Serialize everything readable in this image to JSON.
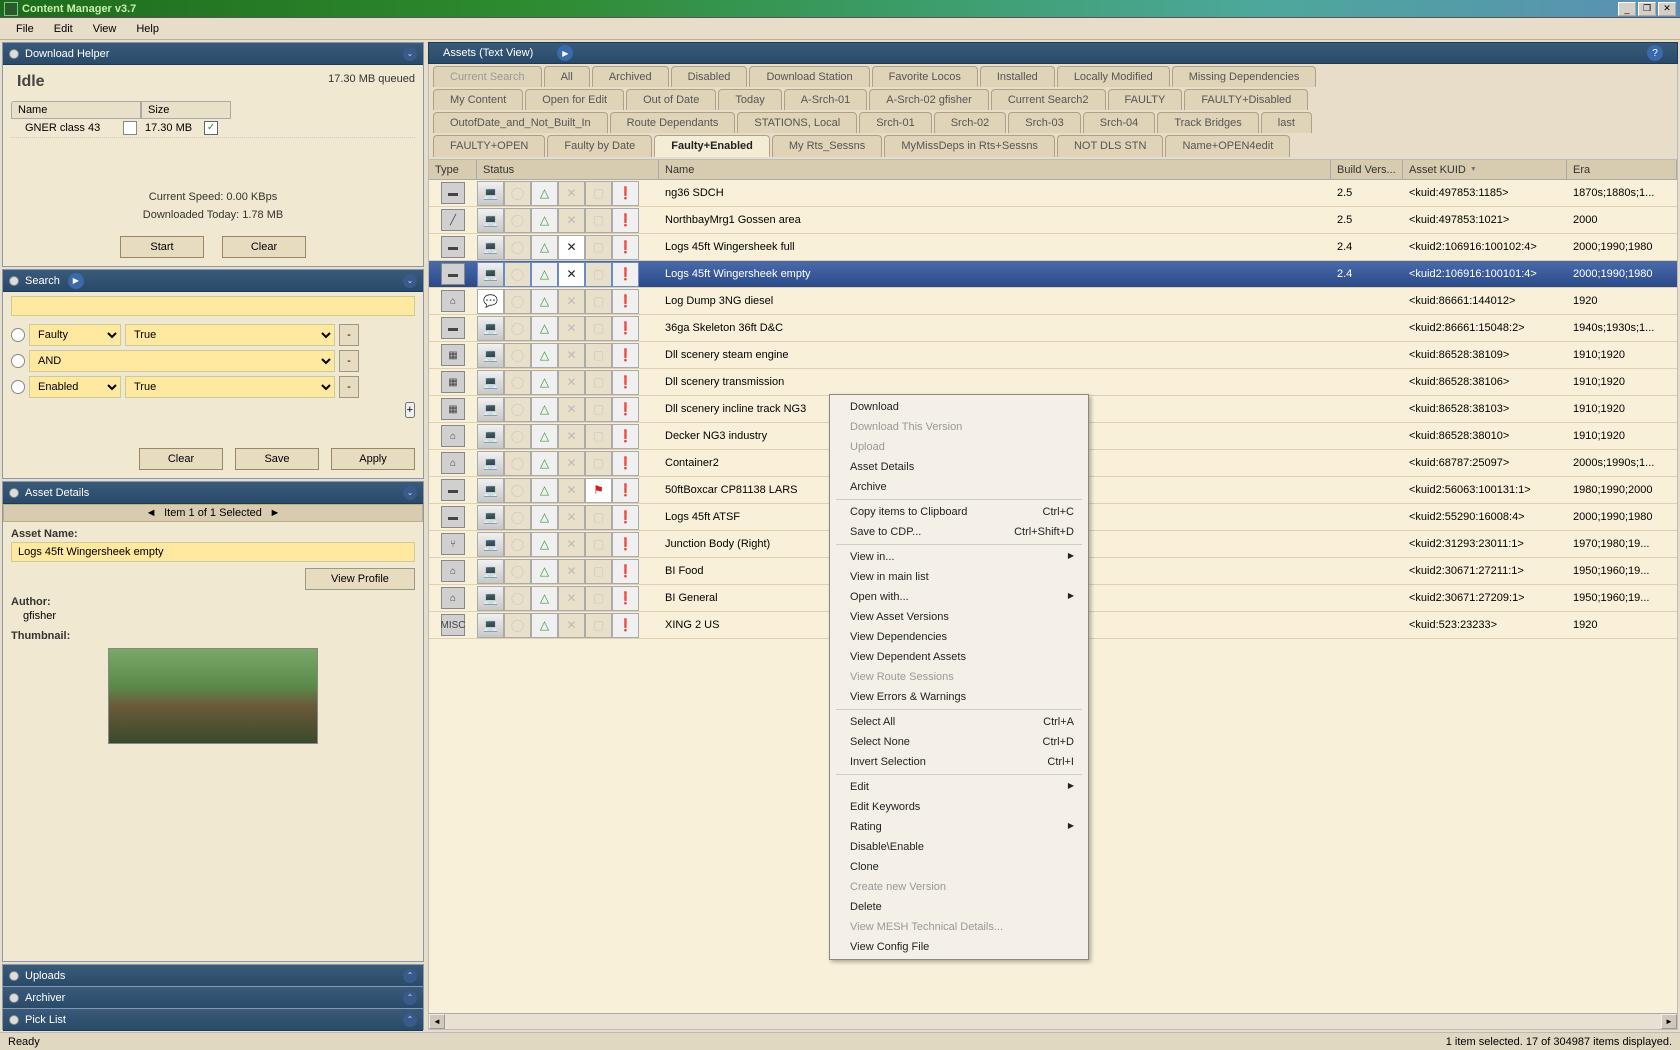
{
  "title": "Content Manager v3.7",
  "menu": [
    "File",
    "Edit",
    "View",
    "Help"
  ],
  "dl": {
    "hdr": "Download Helper",
    "idle": "Idle",
    "queued": "17.30 MB queued",
    "col_name": "Name",
    "col_size": "Size",
    "row_name": "GNER class 43",
    "row_size": "17.30 MB",
    "speed": "Current Speed: 0.00 KBps",
    "today": "Downloaded Today: 1.78 MB",
    "start": "Start",
    "clear": "Clear"
  },
  "search": {
    "hdr": "Search",
    "r1a": "Faulty",
    "r1b": "True",
    "r2a": "AND",
    "r3a": "Enabled",
    "r3b": "True",
    "minus": "-",
    "plus": "+",
    "clear": "Clear",
    "save": "Save",
    "apply": "Apply"
  },
  "details": {
    "hdr": "Asset Details",
    "nav": "Item 1 of 1 Selected",
    "name_lbl": "Asset Name:",
    "name": "Logs 45ft Wingersheek empty",
    "author_lbl": "Author:",
    "author": "gfisher",
    "thumb_lbl": "Thumbnail:",
    "view": "View Profile"
  },
  "left_collapsed": [
    "Uploads",
    "Archiver",
    "Pick List"
  ],
  "assets_hdr": "Assets (Text View)",
  "tabs": [
    [
      "Current Search",
      "All",
      "Archived",
      "Disabled",
      "Download Station",
      "Favorite Locos",
      "Installed",
      "Locally Modified",
      "Missing Dependencies"
    ],
    [
      "My Content",
      "Open for Edit",
      "Out of Date",
      "Today",
      "A-Srch-01",
      "A-Srch-02 gfisher",
      "Current Search2",
      "FAULTY",
      "FAULTY+Disabled"
    ],
    [
      "OutofDate_and_Not_Built_In",
      "Route Dependants",
      "STATIONS, Local",
      "Srch-01",
      "Srch-02",
      "Srch-03",
      "Srch-04",
      "Track Bridges",
      "last"
    ],
    [
      "FAULTY+OPEN",
      "Faulty by Date",
      "Faulty+Enabled",
      "My Rts_Sessns",
      "MyMissDeps in Rts+Sessns",
      "NOT DLS STN",
      "Name+OPEN4edit"
    ]
  ],
  "tabs_active": "Faulty+Enabled",
  "tabs_dim": "Current Search",
  "cols": {
    "type": "Type",
    "status": "Status",
    "name": "Name",
    "build": "Build Vers...",
    "kuid": "Asset KUID",
    "era": "Era"
  },
  "rows": [
    {
      "t": "freight",
      "n": "ng36 SDCH",
      "b": "2.5",
      "k": "<kuid:497853:1185>",
      "e": "1870s;1880s;1..."
    },
    {
      "t": "track",
      "n": "NorthbayMrg1 Gossen area",
      "b": "2.5",
      "k": "<kuid:497853:1021>",
      "e": "2000"
    },
    {
      "t": "freight",
      "n": "Logs 45ft Wingersheek full",
      "b": "2.4",
      "k": "<kuid2:106916:100102:4>",
      "e": "2000;1990;1980",
      "tool": 1
    },
    {
      "t": "freight",
      "n": "Logs 45ft Wingersheek empty",
      "b": "2.4",
      "k": "<kuid2:106916:100101:4>",
      "e": "2000;1990;1980",
      "sel": 1,
      "tool": 1
    },
    {
      "t": "house",
      "n": "Log Dump 3NG diesel",
      "b": "",
      "k": "<kuid:86661:144012>",
      "e": "1920",
      "chat": 1
    },
    {
      "t": "freight",
      "n": "36ga Skeleton 36ft D&C",
      "b": "",
      "k": "<kuid2:86661:15048:2>",
      "e": "1940s;1930s;1..."
    },
    {
      "t": "ind",
      "n": "Dll scenery steam engine",
      "b": "",
      "k": "<kuid:86528:38109>",
      "e": "1910;1920"
    },
    {
      "t": "ind",
      "n": "Dll scenery transmission",
      "b": "",
      "k": "<kuid:86528:38106>",
      "e": "1910;1920"
    },
    {
      "t": "ind",
      "n": "Dll scenery incline track NG3",
      "b": "",
      "k": "<kuid:86528:38103>",
      "e": "1910;1920"
    },
    {
      "t": "house",
      "n": "Decker NG3 industry",
      "b": "",
      "k": "<kuid:86528:38010>",
      "e": "1910;1920"
    },
    {
      "t": "house",
      "n": "Container2",
      "b": "",
      "k": "<kuid:68787:25097>",
      "e": "2000s;1990s;1..."
    },
    {
      "t": "freight",
      "n": "50ftBoxcar CP81138 LARS",
      "b": "",
      "k": "<kuid2:56063:100131:1>",
      "e": "1980;1990;2000",
      "flag": 1
    },
    {
      "t": "freight",
      "n": "Logs 45ft ATSF",
      "b": "",
      "k": "<kuid2:55290:16008:4>",
      "e": "2000;1990;1980"
    },
    {
      "t": "junc",
      "n": "Junction Body (Right)",
      "b": "",
      "k": "<kuid2:31293:23011:1>",
      "e": "1970;1980;19..."
    },
    {
      "t": "house",
      "n": "BI Food",
      "b": "",
      "k": "<kuid2:30671:27211:1>",
      "e": "1950;1960;19..."
    },
    {
      "t": "house",
      "n": "BI General",
      "b": "",
      "k": "<kuid2:30671:27209:1>",
      "e": "1950;1960;19..."
    },
    {
      "t": "misc",
      "n": "XING 2 US",
      "b": "",
      "k": "<kuid:523:23233>",
      "e": "1920"
    }
  ],
  "ctx": [
    {
      "l": "Download"
    },
    {
      "l": "Download This Version",
      "d": 1
    },
    {
      "l": "Upload",
      "d": 1
    },
    {
      "l": "Asset Details"
    },
    {
      "l": "Archive"
    },
    {
      "sep": 1
    },
    {
      "l": "Copy items to Clipboard",
      "s": "Ctrl+C"
    },
    {
      "l": "Save to CDP...",
      "s": "Ctrl+Shift+D"
    },
    {
      "sep": 1
    },
    {
      "l": "View in...",
      "sub": 1
    },
    {
      "l": "View in main list"
    },
    {
      "l": "Open with...",
      "sub": 1
    },
    {
      "l": "View Asset Versions"
    },
    {
      "l": "View Dependencies"
    },
    {
      "l": "View Dependent Assets"
    },
    {
      "l": "View Route Sessions",
      "d": 1
    },
    {
      "l": "View Errors & Warnings"
    },
    {
      "sep": 1
    },
    {
      "l": "Select All",
      "s": "Ctrl+A"
    },
    {
      "l": "Select None",
      "s": "Ctrl+D"
    },
    {
      "l": "Invert Selection",
      "s": "Ctrl+I"
    },
    {
      "sep": 1
    },
    {
      "l": "Edit",
      "sub": 1
    },
    {
      "l": "Edit Keywords"
    },
    {
      "l": "Rating",
      "sub": 1
    },
    {
      "l": "Disable\\Enable"
    },
    {
      "l": "Clone"
    },
    {
      "l": "Create new Version",
      "d": 1
    },
    {
      "l": "Delete"
    },
    {
      "l": "View MESH Technical Details...",
      "d": 1
    },
    {
      "l": "View Config File"
    }
  ],
  "status_l": "Ready",
  "status_r": "1 item selected. 17 of 304987 items displayed."
}
